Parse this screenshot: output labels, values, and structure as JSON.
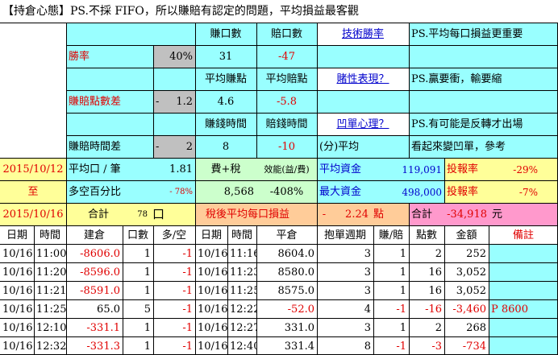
{
  "colors": {
    "cyan": "#99ffff",
    "yellow": "#ffff99",
    "green": "#ccffcc",
    "orange": "#ffcc99",
    "pink": "#ff99cc",
    "gray": "#c0c0c0",
    "white": "#ffffff",
    "red": "#e00000",
    "blue": "#0000cc"
  },
  "title": "【持倉心態】PS.不採 FIFO，所以賺賠有認定的問題，平均損益最客觀",
  "summary": {
    "win_trades_label": "賺口數",
    "loss_trades_label": "賠口數",
    "link_tech": "技術勝率",
    "note1": "PS.平均每口損益更重要",
    "win_rate_label": "勝率",
    "win_rate": "40%",
    "win_trades": "31",
    "loss_trades": "-47",
    "avg_win_label": "平均賺點",
    "avg_loss_label": "平均賠點",
    "link_gamble": "賭性表現？",
    "note2": "PS.贏要衝，輸要縮",
    "pl_points_diff_label": "賺賠點數差",
    "pl_points_diff_sign": "-",
    "pl_points_diff": "1.2",
    "avg_win": "4.6",
    "avg_loss": "-5.8",
    "win_time_label": "賺錢時間",
    "loss_time_label": "賠錢時間",
    "link_mental": "凹單心理？",
    "note3": "PS.有可能是反轉才出場",
    "pl_time_diff_label": "賺賠時間差",
    "pl_time_diff_sign": "-",
    "pl_time_diff": "2",
    "win_time": "8",
    "loss_time": "-10",
    "time_avg_label": "(分)平均",
    "note4": "看起來變凹單，參考",
    "date_from": "2015/10/12",
    "to_label": "至",
    "date_to": "2015/10/16",
    "avg_per_lot_label": "平均口 / 筆",
    "avg_per_lot": "1.81",
    "fee_tax_label": "費+稅",
    "efficiency_label": "效能(益/費)",
    "avg_capital_label": "平均資金",
    "avg_capital": "119,091",
    "roi_label": "投報率",
    "roi": "-29%",
    "long_short_label": "多空百分比",
    "long_short": "- 78%",
    "fee_tax": "8,568",
    "efficiency": "-408%",
    "max_capital_label": "最大資金",
    "max_capital": "498,000",
    "roi2_label": "投報率",
    "roi2": "-7%",
    "total_label": "合計",
    "total_lots": "78",
    "lot_unit": "口",
    "after_tax_label": "稅後平均每口損益",
    "after_tax_sign": "-",
    "after_tax": "2.24",
    "point_unit": "點",
    "grand_total_label": "合計",
    "grand_total": "-34,918",
    "currency": "元"
  },
  "table": {
    "headers": [
      "日期",
      "時間",
      "建倉",
      "口數",
      "多/空",
      "日期",
      "時間",
      "平倉",
      "抱單週期",
      "賺/賠",
      "點數",
      "金額",
      "備註"
    ],
    "rows": [
      [
        "10/16",
        "11:00",
        "-8606.0",
        "1",
        "-1",
        "10/16",
        "11:16",
        "8604.0",
        "3",
        "1",
        "2",
        "252",
        ""
      ],
      [
        "10/16",
        "11:20",
        "-8596.0",
        "1",
        "-1",
        "10/16",
        "11:23",
        "8580.0",
        "3",
        "1",
        "16",
        "3,052",
        ""
      ],
      [
        "10/16",
        "11:21",
        "-8591.0",
        "1",
        "-1",
        "10/16",
        "11:25",
        "8575.0",
        "3",
        "1",
        "16",
        "3,052",
        ""
      ],
      [
        "10/16",
        "11:25",
        "65.0",
        "5",
        "-1",
        "10/16",
        "12:22",
        "-52.0",
        "4",
        "-1",
        "-16",
        "-3,460",
        "P 8600"
      ],
      [
        "10/16",
        "12:10",
        "-331.1",
        "1",
        "-1",
        "10/16",
        "12:27",
        "331.0",
        "3",
        "1",
        "2",
        "268",
        ""
      ],
      [
        "10/16",
        "12:32",
        "-331.3",
        "1",
        "-1",
        "10/16",
        "12:40",
        "331.4",
        "8",
        "-1",
        "-3",
        "-734",
        ""
      ]
    ]
  }
}
